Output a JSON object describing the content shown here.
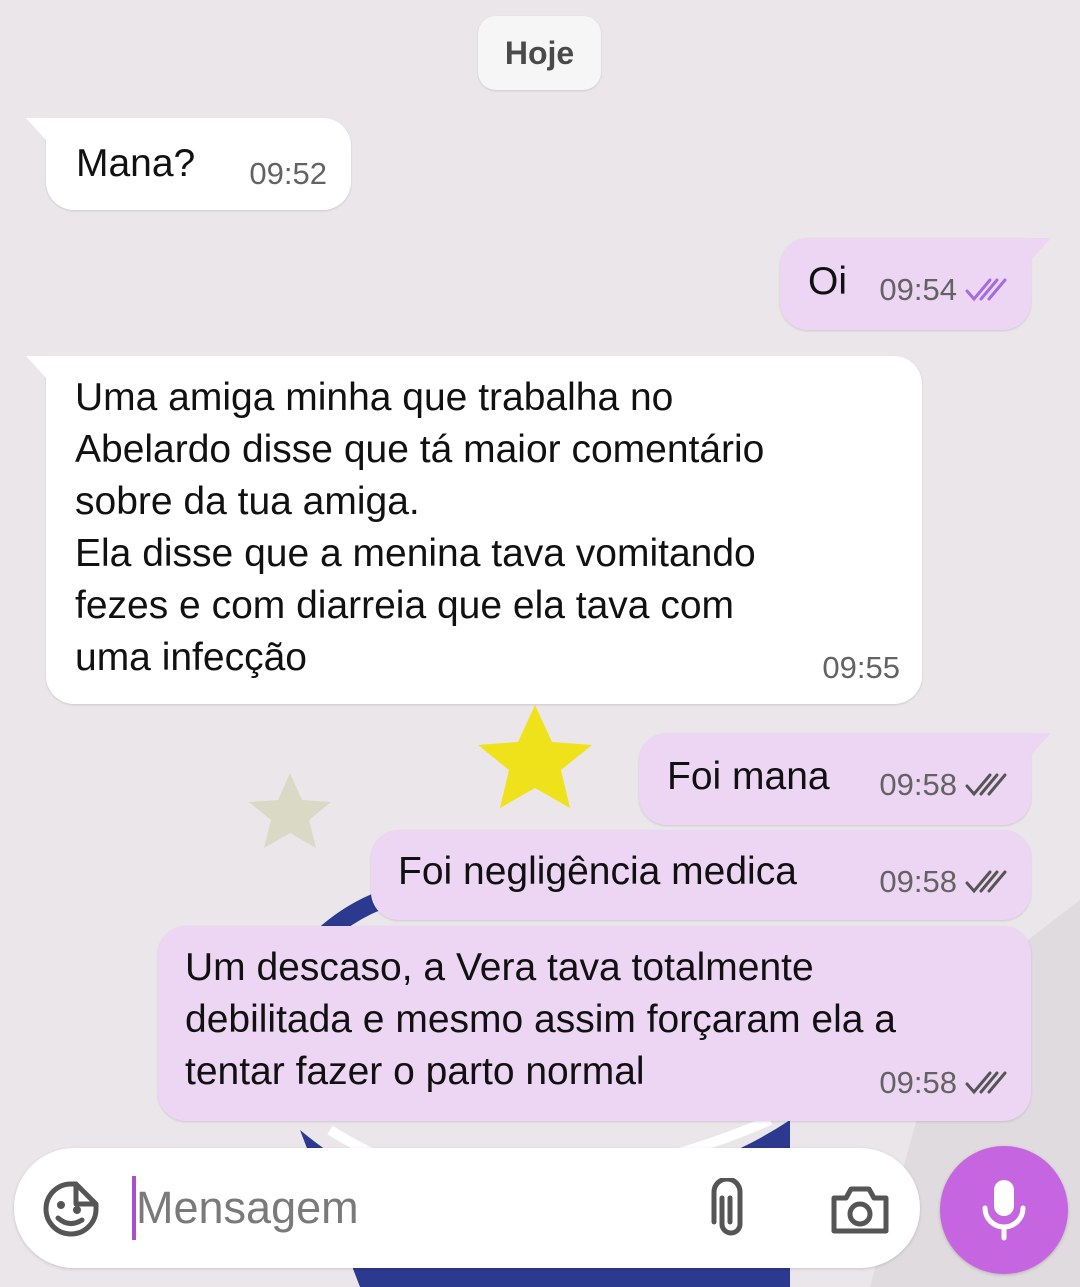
{
  "date_divider": "Hoje",
  "messages": [
    {
      "direction": "incoming",
      "text": "Mana?",
      "time": "09:52"
    },
    {
      "direction": "outgoing",
      "text": "Oi",
      "time": "09:54",
      "ticks": "read",
      "tick_color": "#a36de0"
    },
    {
      "direction": "incoming",
      "text": "Uma amiga minha que trabalha no\nAbelardo disse que tá maior comentário\nsobre da tua amiga.\nEla disse que a menina tava vomitando\nfezes e com diarreia que ela tava com\numa infecção",
      "time": "09:55"
    },
    {
      "direction": "outgoing",
      "text": "Foi mana",
      "time": "09:58",
      "ticks": "delivered",
      "tick_color": "#555555"
    },
    {
      "direction": "outgoing",
      "text": "Foi negligência medica",
      "time": "09:58",
      "ticks": "delivered",
      "tick_color": "#555555"
    },
    {
      "direction": "outgoing",
      "text": "Um descaso, a Vera tava totalmente\ndebilitada e mesmo assim forçaram ela a\ntentar fazer o parto normal",
      "time": "09:58",
      "ticks": "delivered",
      "tick_color": "#555555"
    }
  ],
  "composer": {
    "placeholder": "Mensagem",
    "icons": {
      "left": "sticker-icon",
      "attach": "paperclip-icon",
      "camera": "camera-icon",
      "mic": "microphone-icon"
    }
  },
  "colors": {
    "incoming_bubble": "#ffffff",
    "outgoing_bubble": "#ecd6f3",
    "mic_button": "#c565df",
    "caret": "#a84fd0"
  }
}
